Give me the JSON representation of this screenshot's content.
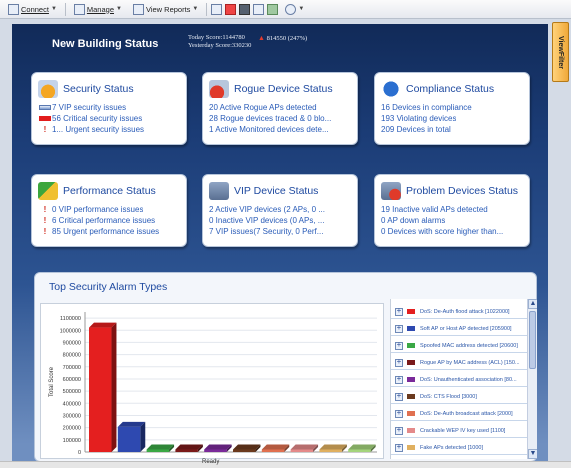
{
  "toolbar": {
    "connect_label": "Connect",
    "manage_label": "Manage",
    "view_reports_label": "View Reports"
  },
  "side_tab": {
    "label": "ViewFilter"
  },
  "header": {
    "title": "New Building Status",
    "today_score": "Today Score:1144780",
    "yesterday_score": "Yesterday Score:330230",
    "score_delta": "814550 (247%)"
  },
  "cards": {
    "security": {
      "title": "Security Status",
      "lines": [
        "7 VIP security issues",
        "56 Critical security issues",
        "1... Urgent security issues"
      ]
    },
    "rogue": {
      "title": "Rogue Device Status",
      "lines": [
        "20 Active Rogue APs detected",
        "28 Rogue devices traced & 0 blo...",
        "1 Active Monitored devices dete..."
      ]
    },
    "compliance": {
      "title": "Compliance Status",
      "lines": [
        "16 Devices in compliance",
        "193 Violating devices",
        "209 Devices in total"
      ]
    },
    "performance": {
      "title": "Performance Status",
      "lines": [
        "0 VIP performance issues",
        "6 Critical performance issues",
        "85 Urgent performance issues"
      ]
    },
    "vip": {
      "title": "VIP Device Status",
      "lines": [
        "2 Active VIP devices (2 APs, 0 ...",
        "0 Inactive VIP devices (0 APs, ...",
        "7 VIP issues(7 Security, 0 Perf..."
      ]
    },
    "problem": {
      "title": "Problem Devices Status",
      "lines": [
        "19 Inactive valid APs detected",
        "0 AP down alarms",
        "0 Devices with score higher than..."
      ]
    }
  },
  "alarm_panel": {
    "title": "Top Security Alarm Types"
  },
  "chart_data": {
    "type": "bar",
    "title": "",
    "xlabel": "",
    "ylabel": "Total Score",
    "ylim": [
      0,
      1150000
    ],
    "y_ticks": [
      "0",
      "100000",
      "200000",
      "300000",
      "400000",
      "500000",
      "600000",
      "700000",
      "800000",
      "900000",
      "1000000",
      "1100000"
    ],
    "grid": true,
    "categories": [
      "DoS: De-Auth flood attack [1022000]",
      "Soft AP or Host AP detected [205900]",
      "Spoofed MAC address detected [20600]",
      "Rogue AP by MAC address (ACL) [150...",
      "DoS: Unauthenticated association [80...",
      "DoS: CTS Flood [3000]",
      "DoS: De-Auth broadcast attack [2000]",
      "Crackable WEP IV key used [1100]",
      "Fake APs detected [1000]",
      ""
    ],
    "values": [
      1022000,
      205900,
      20600,
      15000,
      8000,
      3000,
      2000,
      1100,
      1000,
      1000
    ],
    "colors": [
      "#e41f1f",
      "#2e49b0",
      "#3aa845",
      "#7a1a1a",
      "#7a2a9a",
      "#6b3a1e",
      "#e07050",
      "#e48a8a",
      "#e0b060",
      "#a4d47c"
    ]
  },
  "status": {
    "text": "Ready"
  }
}
